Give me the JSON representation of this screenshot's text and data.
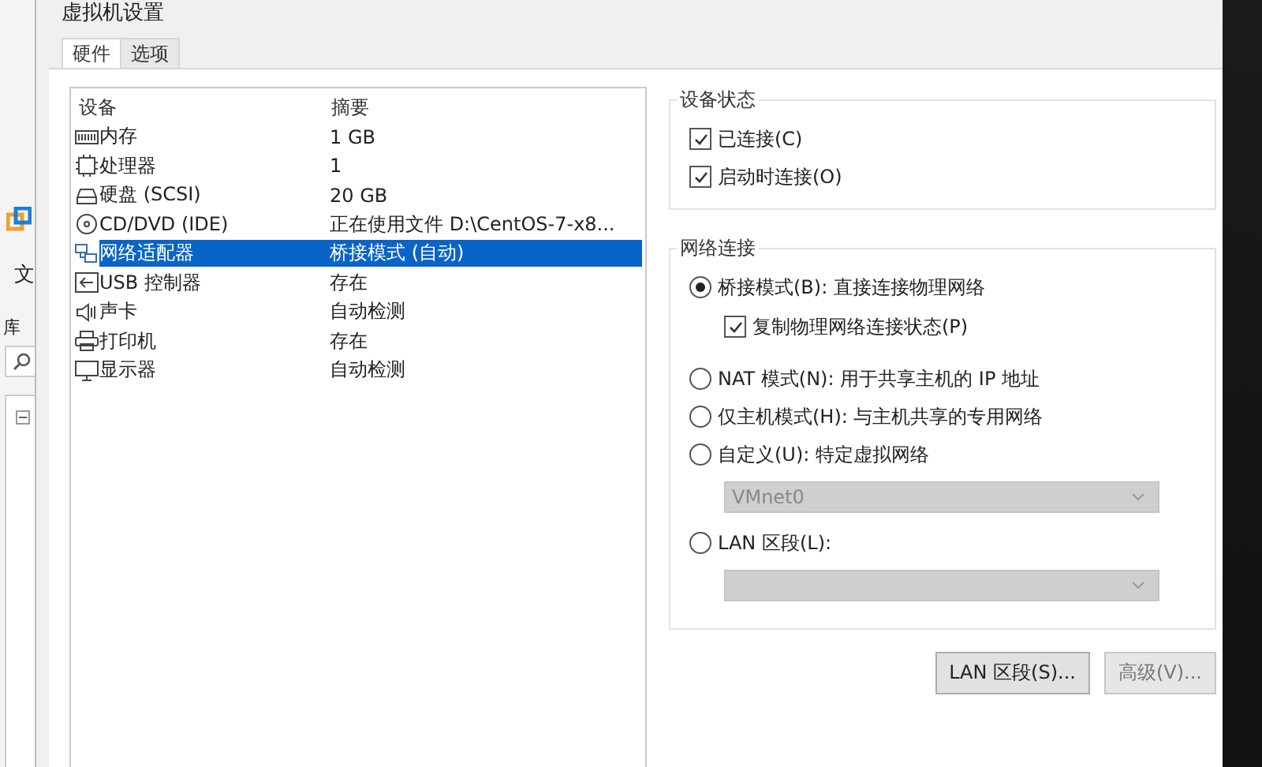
{
  "background_window": {
    "menu_label": "文",
    "library_label": "库"
  },
  "window": {
    "title": "虚拟机设置"
  },
  "tabs": [
    {
      "label": "硬件",
      "selected": true
    },
    {
      "label": "选项",
      "selected": false
    }
  ],
  "device_list": {
    "columns": [
      "设备",
      "摘要"
    ],
    "rows": [
      {
        "kind": "memory",
        "device": "内存",
        "summary": "1 GB",
        "selected": false
      },
      {
        "kind": "cpu",
        "device": "处理器",
        "summary": "1",
        "selected": false
      },
      {
        "kind": "disk",
        "device": "硬盘 (SCSI)",
        "summary": "20 GB",
        "selected": false
      },
      {
        "kind": "cd",
        "device": "CD/DVD (IDE)",
        "summary": "正在使用文件 D:\\CentOS-7-x8...",
        "selected": false
      },
      {
        "kind": "network",
        "device": "网络适配器",
        "summary": "桥接模式 (自动)",
        "selected": true
      },
      {
        "kind": "usb",
        "device": "USB 控制器",
        "summary": "存在",
        "selected": false
      },
      {
        "kind": "sound",
        "device": "声卡",
        "summary": "自动检测",
        "selected": false
      },
      {
        "kind": "printer",
        "device": "打印机",
        "summary": "存在",
        "selected": false
      },
      {
        "kind": "display",
        "device": "显示器",
        "summary": "自动检测",
        "selected": false
      }
    ]
  },
  "device_status": {
    "title": "设备状态",
    "options": [
      {
        "label": "已连接(C)",
        "checked": true
      },
      {
        "label": "启动时连接(O)",
        "checked": true
      }
    ]
  },
  "network_connection": {
    "title": "网络连接",
    "options": [
      {
        "kind": "radio",
        "label": "桥接模式(B): 直接连接物理网络",
        "selected": true
      },
      {
        "kind": "checkbox",
        "label": "复制物理网络连接状态(P)",
        "checked": true
      },
      {
        "kind": "radio",
        "label": "NAT 模式(N): 用于共享主机的 IP 地址",
        "selected": false
      },
      {
        "kind": "radio",
        "label": "仅主机模式(H): 与主机共享的专用网络",
        "selected": false
      },
      {
        "kind": "radio",
        "label": "自定义(U): 特定虚拟网络",
        "selected": false
      },
      {
        "kind": "dropdown",
        "value": "VMnet0",
        "disabled": true
      },
      {
        "kind": "radio",
        "label": "LAN 区段(L):",
        "selected": false
      },
      {
        "kind": "dropdown",
        "disabled": true
      }
    ]
  },
  "buttons": [
    {
      "label": "LAN 区段(S)...",
      "disabled": false
    },
    {
      "label": "高级(V)...",
      "disabled": true
    }
  ]
}
